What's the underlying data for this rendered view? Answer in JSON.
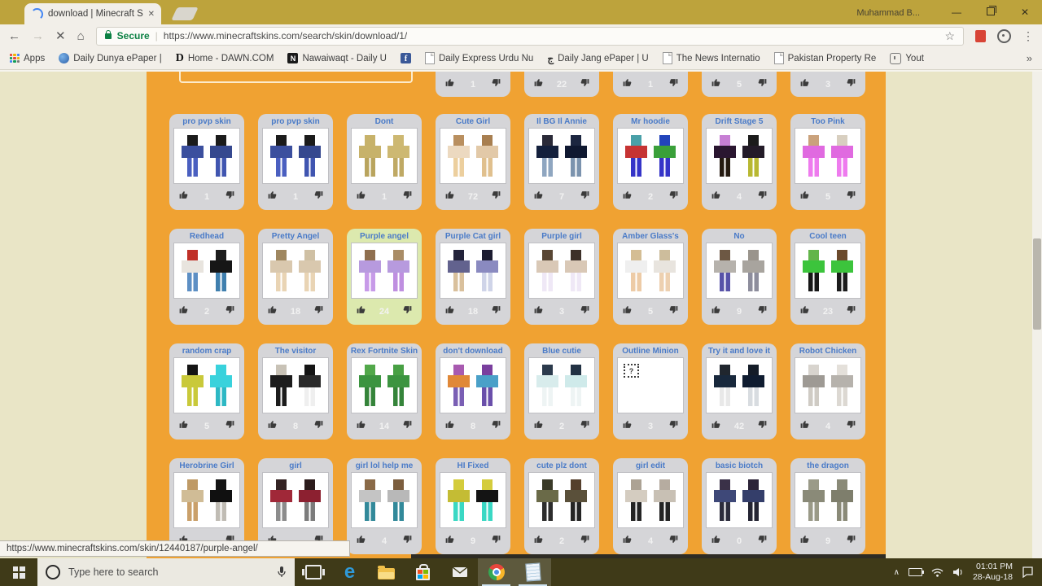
{
  "window": {
    "tab_title": "download | Minecraft Ski",
    "user": "Muhammad B..."
  },
  "icons": {
    "minimize": "—",
    "close": "✕",
    "back": "←",
    "forward": "→",
    "stop": "✕",
    "home": "⌂",
    "star": "☆",
    "dots": "⋮",
    "overflow": "»",
    "chevron_up": "∧",
    "broken_image": "?"
  },
  "browser": {
    "secure_label": "Secure",
    "url": "https://www.minecraftskins.com/search/skin/download/1/",
    "status_url": "https://www.minecraftskins.com/skin/12440187/purple-angel/"
  },
  "bookmarks": {
    "apps_label": "Apps",
    "items": [
      {
        "icon": "globe",
        "label": "Daily Dunya ePaper |"
      },
      {
        "icon": "letter-d",
        "label": "Home - DAWN.COM"
      },
      {
        "icon": "letter-n",
        "label": "Nawaiwaqt - Daily U"
      },
      {
        "icon": "facebook",
        "label": ""
      },
      {
        "icon": "page",
        "label": "Daily Express Urdu Nu"
      },
      {
        "icon": "jang",
        "label": "Daily Jang ePaper | U"
      },
      {
        "icon": "page",
        "label": "The News Internatio"
      },
      {
        "icon": "page",
        "label": "Pakistan Property Re"
      },
      {
        "icon": "yout",
        "label": "Yout"
      }
    ]
  },
  "content": {
    "accent_orange": "#f0a232",
    "highlight_green": "#dce9ae",
    "name_blue": "#4a7bc8",
    "partial_counts": [
      "1",
      "22",
      "1",
      "5",
      "3"
    ],
    "rows": [
      [
        {
          "name": "pro pvp skin",
          "count": "1",
          "fig1": [
            "#1b1b1b",
            "#3b4f9e",
            "#4a5fc0"
          ],
          "fig2": [
            "#1b1b1b",
            "#35488f",
            "#4055b0"
          ]
        },
        {
          "name": "pro pvp skin",
          "count": "1",
          "fig1": [
            "#1b1b1b",
            "#3b4f9e",
            "#4a5fc0"
          ],
          "fig2": [
            "#1b1b1b",
            "#35488f",
            "#4055b0"
          ]
        },
        {
          "name": "Dont",
          "count": "1",
          "fig1": [
            "#c7b26a",
            "#c7b26a",
            "#b9a45e"
          ],
          "fig2": [
            "#cdb872",
            "#cdb872",
            "#bfa964"
          ]
        },
        {
          "name": "Cute Girl",
          "count": "72",
          "fig1": [
            "#b98f5f",
            "#ecd9c0",
            "#eccf9e"
          ],
          "fig2": [
            "#a87f50",
            "#e2c9a8",
            "#e0c08e"
          ]
        },
        {
          "name": "Il BG Il Annie",
          "count": "7",
          "fig1": [
            "#2a2a38",
            "#14203c",
            "#8fa6c0"
          ],
          "fig2": [
            "#1c2640",
            "#0f1830",
            "#7b93ae"
          ]
        },
        {
          "name": "Mr hoodie",
          "count": "2",
          "fig1": [
            "#49a0a8",
            "#c63333",
            "#3534c8"
          ],
          "fig2": [
            "#2244bb",
            "#3aa03a",
            "#3534c8"
          ]
        },
        {
          "name": "Drift Stage 5",
          "count": "4",
          "fig1": [
            "#c77fd4",
            "#2a1630",
            "#241a10"
          ],
          "fig2": [
            "#1b1b1b",
            "#231b28",
            "#b8b832"
          ]
        },
        {
          "name": "Too Pink",
          "count": "5",
          "fig1": [
            "#caa27c",
            "#e06ae0",
            "#ee7bee"
          ],
          "fig2": [
            "#d8cfc0",
            "#e06ae0",
            "#ee7bee"
          ]
        }
      ],
      [
        {
          "name": "Redhead",
          "count": "2",
          "fig1": [
            "#c03028",
            "#e8e4de",
            "#5d8fc4"
          ],
          "fig2": [
            "#1c1c1c",
            "#161616",
            "#3f7fae"
          ]
        },
        {
          "name": "Pretty Angel",
          "count": "18",
          "fig1": [
            "#9f8760",
            "#d9c8ae",
            "#e9d4b4"
          ],
          "fig2": [
            "#cfc0a4",
            "#d9c8ae",
            "#e9d4b4"
          ]
        },
        {
          "name": "Purple angel",
          "count": "24",
          "highlighted": true,
          "fig1": [
            "#8f6f4f",
            "#b79ade",
            "#c79ae8"
          ],
          "fig2": [
            "#a98c66",
            "#b79ade",
            "#bf8fe0"
          ]
        },
        {
          "name": "Purple Cat girl",
          "count": "18",
          "fig1": [
            "#23233a",
            "#62628e",
            "#d9c09c"
          ],
          "fig2": [
            "#1c1c30",
            "#8a8ac0",
            "#cfd4e8"
          ]
        },
        {
          "name": "Purple girl",
          "count": "3",
          "fig1": [
            "#584634",
            "#d9c8b6",
            "#efe8f6"
          ],
          "fig2": [
            "#3c3028",
            "#d9c8b6",
            "#efe8f6"
          ]
        },
        {
          "name": "Amber Glass's",
          "count": "5",
          "fig1": [
            "#d4bd94",
            "#efefef",
            "#edcba6"
          ],
          "fig2": [
            "#cdbd9c",
            "#e8e4de",
            "#edd0b0"
          ]
        },
        {
          "name": "No",
          "count": "9",
          "fig1": [
            "#6d5844",
            "#b6b2ac",
            "#5752a8"
          ],
          "fig2": [
            "#9a948c",
            "#a8a49e",
            "#8d8d9c"
          ]
        },
        {
          "name": "Cool teen",
          "count": "23",
          "fig1": [
            "#63b54a",
            "#3cc43c",
            "#161616"
          ],
          "fig2": [
            "#6b4a2c",
            "#3cc43c",
            "#1c1c1c"
          ]
        }
      ],
      [
        {
          "name": "random crap",
          "count": "5",
          "fig1": [
            "#141414",
            "#c9c93a",
            "#c9c93a"
          ],
          "fig2": [
            "#39d2dc",
            "#39d2dc",
            "#2db8c4"
          ]
        },
        {
          "name": "The visitor",
          "count": "8",
          "fig1": [
            "#c8c2b6",
            "#1c1c1c",
            "#1c1c1c"
          ],
          "fig2": [
            "#141414",
            "#2a2a2a",
            "#efefef"
          ]
        },
        {
          "name": "Rex Fortnite Skin",
          "count": "14",
          "fig1": [
            "#52a84a",
            "#3c9440",
            "#35843a"
          ],
          "fig2": [
            "#48a044",
            "#3c9440",
            "#35843a"
          ]
        },
        {
          "name": "don't download",
          "count": "8",
          "fig1": [
            "#a85ab0",
            "#e08838",
            "#7a5fb4"
          ],
          "fig2": [
            "#7a3f9e",
            "#4aa0c8",
            "#6a4faa"
          ]
        },
        {
          "name": "Blue cutie",
          "count": "2",
          "fig1": [
            "#2b3a4c",
            "#d8ecec",
            "#eef4f4"
          ],
          "fig2": [
            "#223244",
            "#cfeaea",
            "#eef4f4"
          ]
        },
        {
          "name": "Outline Minion",
          "count": "3",
          "broken": true
        },
        {
          "name": "Try it and love it",
          "count": "42",
          "fig1": [
            "#20262e",
            "#18283c",
            "#e8e8e8"
          ],
          "fig2": [
            "#141c28",
            "#0f1c30",
            "#d8dce0"
          ]
        },
        {
          "name": "Robot Chicken",
          "count": "4",
          "fig1": [
            "#d8d4ce",
            "#9e9a94",
            "#cfcbc4"
          ],
          "fig2": [
            "#e4e0da",
            "#b6b2ac",
            "#dcd8d2"
          ]
        }
      ],
      [
        {
          "name": "Herobrine Girl",
          "count": "",
          "fig1": [
            "#bf9a66",
            "#d0bc96",
            "#caa06a"
          ],
          "fig2": [
            "#141414",
            "#101010",
            "#c0bcb4"
          ]
        },
        {
          "name": "girl",
          "count": "",
          "fig1": [
            "#342424",
            "#a02838",
            "#8c8c8c"
          ],
          "fig2": [
            "#2c1c1c",
            "#8c2030",
            "#7c7c7c"
          ]
        },
        {
          "name": "girl lol help me",
          "count": "4",
          "fig1": [
            "#8a6a48",
            "#c4c4c4",
            "#32899a"
          ],
          "fig2": [
            "#7c5e3e",
            "#b8b8b8",
            "#32899a"
          ]
        },
        {
          "name": "HI Fixed",
          "count": "9",
          "fig1": [
            "#d4cc3c",
            "#c4bc34",
            "#3ad8c4"
          ],
          "fig2": [
            "#d4cc3c",
            "#141414",
            "#3ad8c4"
          ]
        },
        {
          "name": "cute plz dont",
          "count": "2",
          "fig1": [
            "#3a3a28",
            "#6a6a48",
            "#2c2c2c"
          ],
          "fig2": [
            "#55402c",
            "#5a503a",
            "#242424"
          ]
        },
        {
          "name": "girl edit",
          "count": "4",
          "fig1": [
            "#aca294",
            "#d4ccc0",
            "#242424"
          ],
          "fig2": [
            "#b6aca0",
            "#c8c0b4",
            "#242424"
          ]
        },
        {
          "name": "basic biotch",
          "count": "0",
          "fig1": [
            "#3a3148",
            "#3e4878",
            "#2c2c3c"
          ],
          "fig2": [
            "#2c2438",
            "#343e6a",
            "#242432"
          ]
        },
        {
          "name": "the dragon",
          "count": "9",
          "fig1": [
            "#9a9a88",
            "#8a8a78",
            "#9a9a88"
          ],
          "fig2": [
            "#8a8a78",
            "#7e7e6c",
            "#8a8a78"
          ]
        }
      ]
    ]
  },
  "taskbar": {
    "search_placeholder": "Type here to search",
    "time": "01:01 PM",
    "date": "28-Aug-18"
  }
}
